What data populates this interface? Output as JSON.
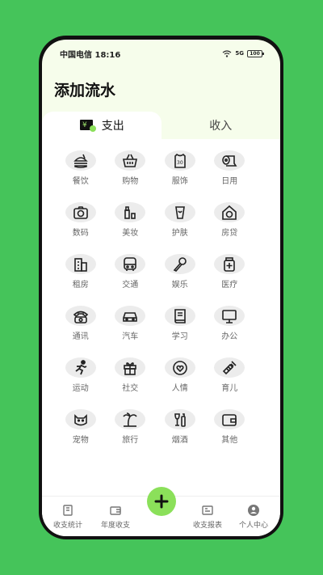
{
  "status_bar": {
    "carrier_time": "中国电信 18:16",
    "signal": "5G",
    "battery": "100"
  },
  "page_title": "添加流水",
  "tabs": [
    {
      "label": "支出",
      "active": true
    },
    {
      "label": "收入",
      "active": false
    }
  ],
  "categories": [
    {
      "label": "餐饮",
      "icon": "burger-icon"
    },
    {
      "label": "购物",
      "icon": "basket-icon"
    },
    {
      "label": "服饰",
      "icon": "jersey-icon"
    },
    {
      "label": "日用",
      "icon": "toilet-paper-icon"
    },
    {
      "label": "数码",
      "icon": "camera-icon"
    },
    {
      "label": "美妆",
      "icon": "lipstick-icon"
    },
    {
      "label": "护肤",
      "icon": "skincare-icon"
    },
    {
      "label": "房贷",
      "icon": "house-dollar-icon"
    },
    {
      "label": "租房",
      "icon": "building-icon"
    },
    {
      "label": "交通",
      "icon": "bus-icon"
    },
    {
      "label": "娱乐",
      "icon": "microphone-icon"
    },
    {
      "label": "医疗",
      "icon": "medicine-icon"
    },
    {
      "label": "通讯",
      "icon": "telephone-icon"
    },
    {
      "label": "汽车",
      "icon": "car-icon"
    },
    {
      "label": "学习",
      "icon": "book-icon"
    },
    {
      "label": "办公",
      "icon": "monitor-icon"
    },
    {
      "label": "运动",
      "icon": "runner-icon"
    },
    {
      "label": "社交",
      "icon": "gift-icon"
    },
    {
      "label": "人情",
      "icon": "heart-bubble-icon"
    },
    {
      "label": "育儿",
      "icon": "baby-bottle-icon"
    },
    {
      "label": "宠物",
      "icon": "cat-icon"
    },
    {
      "label": "旅行",
      "icon": "palm-tree-icon"
    },
    {
      "label": "烟酒",
      "icon": "wine-icon"
    },
    {
      "label": "其他",
      "icon": "wallet-icon"
    }
  ],
  "bottom_nav": [
    {
      "label": "收支统计",
      "icon": "stats-icon"
    },
    {
      "label": "年度收支",
      "icon": "annual-icon"
    },
    {
      "label": "收支报表",
      "icon": "report-icon"
    },
    {
      "label": "个人中心",
      "icon": "user-icon"
    }
  ],
  "colors": {
    "background": "#45c45a",
    "accent": "#8be05a",
    "header": "#f6fdeb"
  }
}
